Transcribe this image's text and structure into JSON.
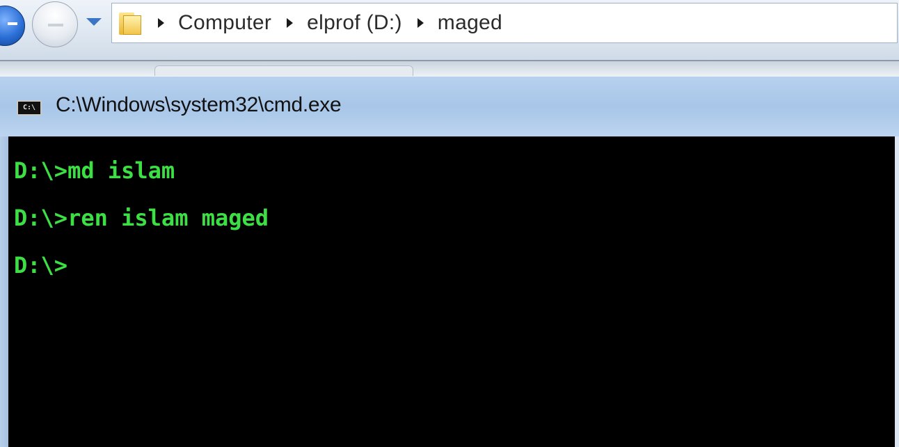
{
  "explorer": {
    "breadcrumbs": [
      {
        "label": "Computer"
      },
      {
        "label": "elprof (D:)"
      },
      {
        "label": "maged"
      }
    ],
    "icons": {
      "back": "back-arrow-icon",
      "forward": "forward-arrow-icon",
      "history": "chevron-down-icon",
      "folder": "folder-icon"
    }
  },
  "cmd": {
    "title": "C:\\Windows\\system32\\cmd.exe",
    "icon_label": "C:\\",
    "text_color": "#3ce045",
    "background": "#000000",
    "lines": [
      "D:\\>md islam",
      "D:\\>ren islam maged",
      "D:\\>"
    ]
  }
}
